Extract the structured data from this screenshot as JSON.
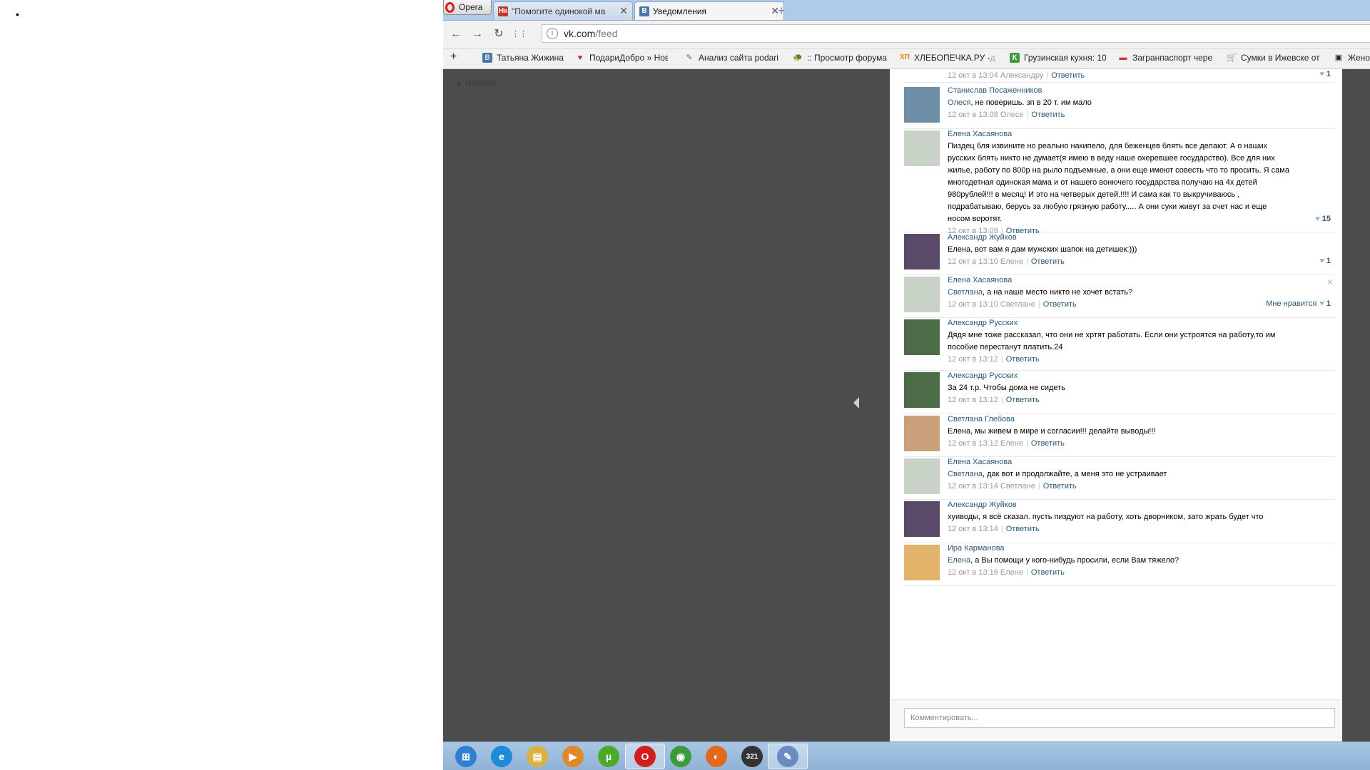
{
  "desktop": {
    "bullet": "•"
  },
  "browser": {
    "opera_label": "Opera",
    "tabs": [
      {
        "favicon": "Нк",
        "title": "\"Помогите одинокой ма",
        "close": "✕"
      },
      {
        "favicon": "В",
        "title": "Уведомления",
        "close": "✕"
      }
    ],
    "new_tab": "+",
    "nav": {
      "back": "←",
      "forward": "→",
      "reload": "↻",
      "speed_dial": "⋮⋮",
      "info": "i"
    },
    "url_domain": "vk.com",
    "url_path": "/feed",
    "bookmarks_add": "+",
    "bookmarks": [
      {
        "icon": "В",
        "label": "Татьяна Жижина",
        "fade": ""
      },
      {
        "icon": "♥",
        "label": "ПодариДобро » Нов",
        "fade": ""
      },
      {
        "icon": "✎",
        "label": "Анализ сайта podari",
        "fade": ""
      },
      {
        "icon": "🐢",
        "label": ":: Просмотр форума",
        "fade": ""
      },
      {
        "icon": "ХП",
        "label": "ХЛЕБОПЕЧКА.РУ - ",
        "fade": "д"
      },
      {
        "icon": "К",
        "label": "Грузинская кухня: 10",
        "fade": ""
      },
      {
        "icon": "▬",
        "label": "Загранпаспорт чере",
        "fade": ""
      },
      {
        "icon": "🛒",
        "label": "Сумки в Ижевске от",
        "fade": ""
      },
      {
        "icon": "▣",
        "label": "Жено",
        "fade": ""
      }
    ]
  },
  "page": {
    "up_label": "Наверх",
    "top_meta": {
      "time": "12 окт в 13:04 Александру",
      "reply": "Ответить",
      "likes": "1"
    },
    "comments": [
      {
        "author": "Станислав Посаженников",
        "reply_to": "Олеся",
        "text": ", не поверишь. зп в 20 т. им мало",
        "time": "12 окт в 13:08 Олесе",
        "reply": "Ответить",
        "likes": "",
        "like_label": ""
      },
      {
        "author": "Елена Хасаянова",
        "reply_to": "",
        "text": "Пиздец бля извините но реально накипело, для беженцев блять все делают. А о наших русских блять никто не думает(я имею в веду наше охеревшее государство). Все для них жилье, работу по 800р на рыло подъемные, а они еще имеют совесть что то просить. Я сама многодетная одинокая мама и от нашего вонючего государства получаю на 4х детей 980рублей!!! в месяц! И это на четверых детей.!!!! И сама как то выкручиваюсь , подрабатываю, берусь за любую грязную работу..... А они суки живут за счет нас и еще носом воротят.",
        "time": "12 окт в 13:09",
        "reply": "Ответить",
        "likes": "15",
        "like_label": ""
      },
      {
        "author": "Александр Жуйков",
        "reply_to": "",
        "text": "Елена, вот вам я дам мужских шапок на детишек:)))",
        "time": "12 окт в 13:10 Елене",
        "reply": "Ответить",
        "likes": "1",
        "like_label": ""
      },
      {
        "author": "Елена Хасаянова",
        "reply_to": "Светлана",
        "text": ", а на наше место никто не хочет встать?",
        "time": "12 окт в 13:10 Светлане",
        "reply": "Ответить",
        "likes": "1",
        "like_label": "Мне нравится"
      },
      {
        "author": "Александр Русских",
        "reply_to": "",
        "text": "Дядя мне тоже рассказал, что они не хртят работать. Если они устроятся на работу,то им пособие перестанут платить.24",
        "time": "12 окт в 13:12",
        "reply": "Ответить",
        "likes": "",
        "like_label": ""
      },
      {
        "author": "Александр Русских",
        "reply_to": "",
        "text": "За 24 т.р. Чтобы дома не сидеть",
        "time": "12 окт в 13:12",
        "reply": "Ответить",
        "likes": "",
        "like_label": ""
      },
      {
        "author": "Светлана Глебова",
        "reply_to": "",
        "text": "Елена, мы живем в мире и согласии!!! делайте выводы!!!",
        "time": "12 окт в 13:12 Елене",
        "reply": "Ответить",
        "likes": "",
        "like_label": ""
      },
      {
        "author": "Елена Хасаянова",
        "reply_to": "Светлана",
        "text": ", дак вот и продолжайте, а меня это не устраивает",
        "time": "12 окт в 13:14 Светлане",
        "reply": "Ответить",
        "likes": "",
        "like_label": ""
      },
      {
        "author": "Александр Жуйков",
        "reply_to": "",
        "text": "хуиводы, я всё сказал. пусть пиздуют на работу, хоть дворником, зато жрать будет что",
        "time": "12 окт в 13:14",
        "reply": "Ответить",
        "likes": "",
        "like_label": ""
      },
      {
        "author": "Ира Карманова",
        "reply_to": "Елена",
        "text": ", а Вы помощи у кого-нибудь просили, если Вам тяжело?",
        "time": "12 окт в 13:16 Елене",
        "reply": "Ответить",
        "likes": "",
        "like_label": ""
      }
    ],
    "comment_placeholder": "Комментировать...",
    "heart": "♥",
    "delete": "✕",
    "collapse": "◀"
  },
  "taskbar": {
    "items": [
      {
        "name": "start-button-icon",
        "glyph": "⊞",
        "color": "#2f7fd2"
      },
      {
        "name": "internet-explorer-icon",
        "glyph": "e",
        "color": "#1f8ad6"
      },
      {
        "name": "explorer-folder-icon",
        "glyph": "▤",
        "color": "#d9b13b"
      },
      {
        "name": "media-player-icon",
        "glyph": "▶",
        "color": "#e0892b"
      },
      {
        "name": "utorrent-icon",
        "glyph": "µ",
        "color": "#4caa2b"
      },
      {
        "name": "opera-icon",
        "glyph": "O",
        "color": "#d21e1e"
      },
      {
        "name": "chrome-icon",
        "glyph": "◉",
        "color": "#3b9b3b"
      },
      {
        "name": "firefox-icon",
        "glyph": "◐",
        "color": "#e36a1c"
      },
      {
        "name": "media-player-classic-icon",
        "glyph": "321",
        "color": "#333333"
      },
      {
        "name": "paint-icon",
        "glyph": "✎",
        "color": "#6a8cc0"
      }
    ]
  }
}
